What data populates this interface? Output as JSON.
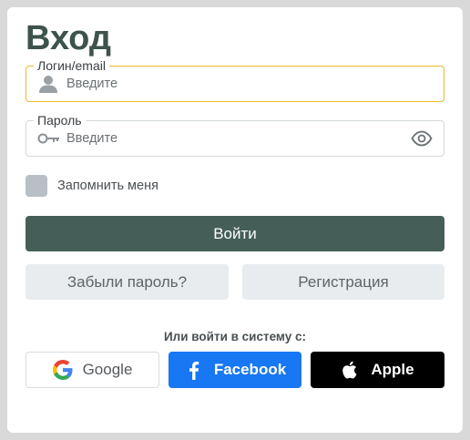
{
  "form": {
    "title": "Вход",
    "login": {
      "label": "Логин/email",
      "placeholder": "Введите",
      "value": ""
    },
    "password": {
      "label": "Пароль",
      "placeholder": "Введите",
      "value": ""
    },
    "remember": {
      "label": "Запомнить меня",
      "checked": false
    },
    "submit_label": "Войти",
    "forgot_label": "Забыли пароль?",
    "register_label": "Регистрация"
  },
  "social": {
    "caption": "Или войти в систему с:",
    "providers": [
      {
        "name": "Google",
        "icon": "google-icon",
        "color": "#ffffff"
      },
      {
        "name": "Facebook",
        "icon": "facebook-icon",
        "color": "#1877f2"
      },
      {
        "name": "Apple",
        "icon": "apple-icon",
        "color": "#000000"
      }
    ]
  },
  "colors": {
    "accent": "#455f58",
    "title": "#3d534b",
    "focus_border": "#e8b931",
    "checkbox": "#b8c0c6",
    "secondary_button": "#e8ecee",
    "page_background": "#d9d9d9"
  },
  "icons": {
    "login_field": "user-icon",
    "password_field": "key-icon",
    "password_toggle": "eye-icon"
  }
}
